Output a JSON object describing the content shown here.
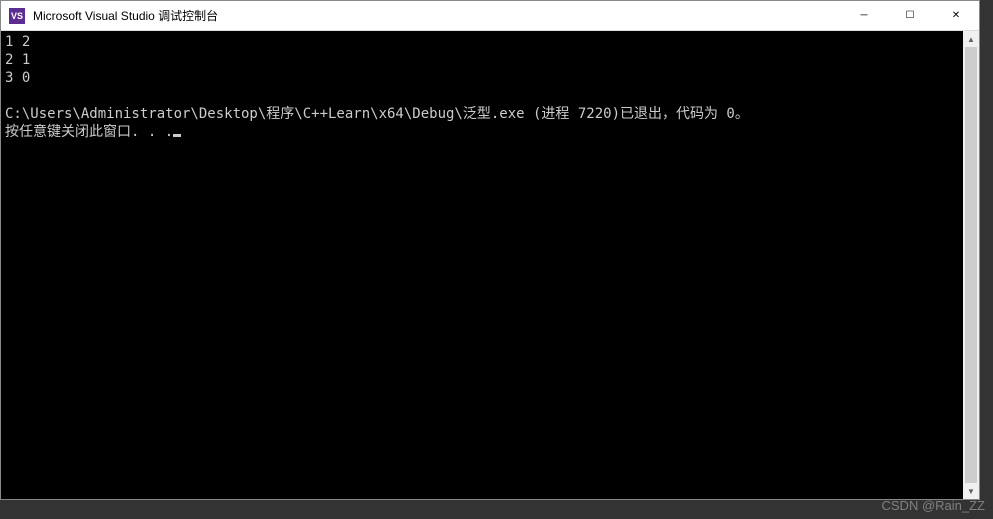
{
  "window": {
    "title": "Microsoft Visual Studio 调试控制台",
    "icon_label": "VS"
  },
  "console": {
    "lines": [
      "1 2",
      "2 1",
      "3 0",
      "",
      "C:\\Users\\Administrator\\Desktop\\程序\\C++Learn\\x64\\Debug\\泛型.exe (进程 7220)已退出，代码为 0。",
      "按任意键关闭此窗口. . ."
    ]
  },
  "controls": {
    "minimize": "─",
    "maximize": "☐",
    "close": "✕"
  },
  "scroll": {
    "up": "▲",
    "down": "▼"
  },
  "watermark": "CSDN @Rain_ZZ"
}
